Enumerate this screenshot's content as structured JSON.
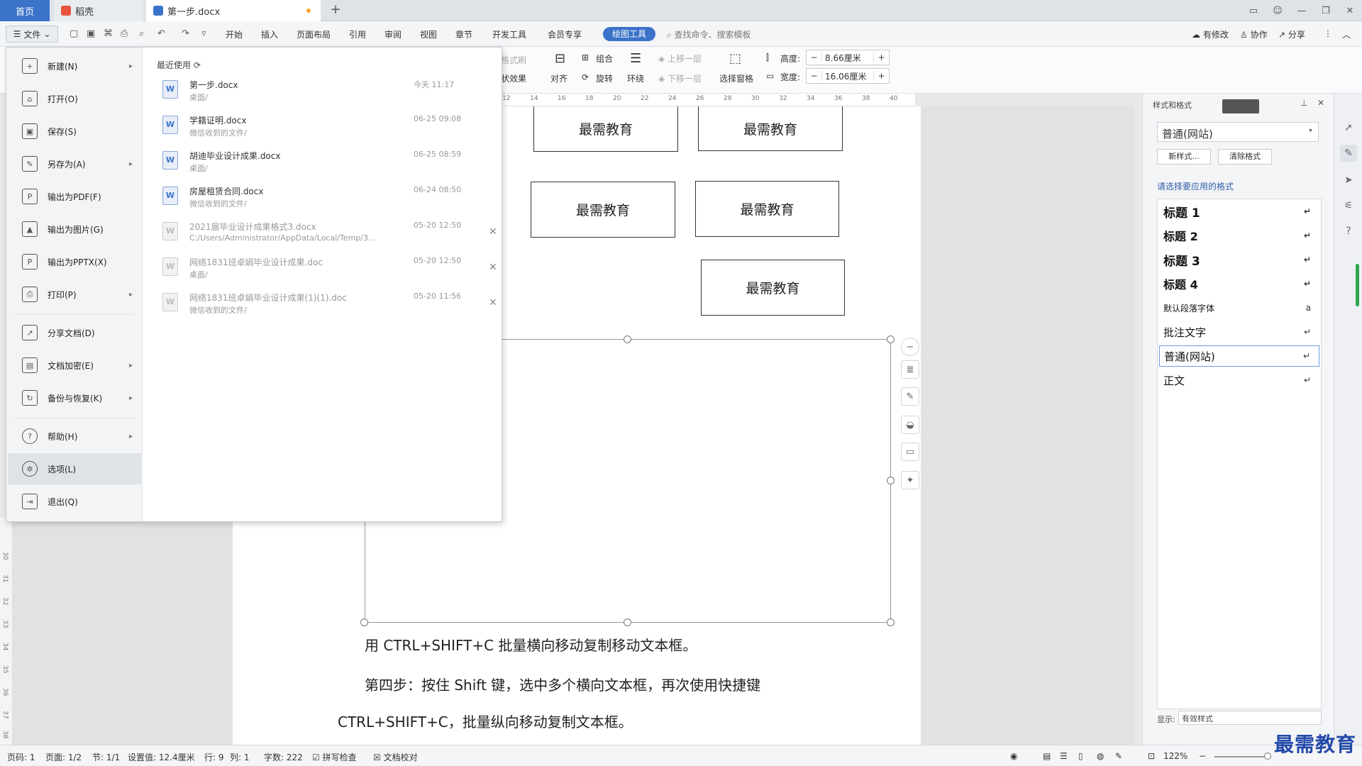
{
  "titlebar": {
    "tab_home": "首页",
    "tab_daoke": "稻壳",
    "tab_doc": "第一步.docx",
    "new_tab": "+"
  },
  "menubar": {
    "file": "文件",
    "items": [
      "开始",
      "插入",
      "页面布局",
      "引用",
      "审阅",
      "视图",
      "章节",
      "开发工具",
      "会员专享"
    ],
    "active_tab": "绘图工具",
    "search": "查找命令、搜索模板",
    "modified": "有修改",
    "collaborate": "协作",
    "share": "分享"
  },
  "ribbon": {
    "format_painter": "格式刷",
    "shape_effect": "状效果",
    "align": "对齐",
    "group": "组合",
    "rotate": "旋转",
    "wrap": "环绕",
    "bring_forward": "上移一层",
    "send_backward": "下移一层",
    "select_pane": "选择窗格",
    "height_label": "高度:",
    "height_value": "8.66厘米",
    "width_label": "宽度:",
    "width_value": "16.06厘米"
  },
  "ruler": {
    "ticks": [
      "12",
      "14",
      "16",
      "18",
      "20",
      "22",
      "24",
      "26",
      "28",
      "30",
      "32",
      "34",
      "36",
      "38",
      "40"
    ]
  },
  "vruler": {
    "ticks": [
      "30",
      "31",
      "32",
      "33",
      "34",
      "35",
      "36",
      "37",
      "38",
      "39"
    ]
  },
  "file_menu": {
    "items": [
      {
        "label": "新建(N)",
        "arrow": true
      },
      {
        "label": "打开(O)",
        "arrow": false
      },
      {
        "label": "保存(S)",
        "arrow": false
      },
      {
        "label": "另存为(A)",
        "arrow": true
      },
      {
        "label": "输出为PDF(F)",
        "arrow": false
      },
      {
        "label": "输出为图片(G)",
        "arrow": false
      },
      {
        "label": "输出为PPTX(X)",
        "arrow": false
      },
      {
        "label": "打印(P)",
        "arrow": true
      },
      {
        "label": "分享文档(D)",
        "arrow": false
      },
      {
        "label": "文档加密(E)",
        "arrow": true
      },
      {
        "label": "备份与恢复(K)",
        "arrow": true
      },
      {
        "label": "帮助(H)",
        "arrow": true
      },
      {
        "label": "选项(L)",
        "arrow": false
      },
      {
        "label": "退出(Q)",
        "arrow": false
      }
    ],
    "recent_title": "最近使用",
    "recent": [
      {
        "name": "第一步.docx",
        "path": "桌面/",
        "time": "今天 11:17",
        "gray": false
      },
      {
        "name": "学籍证明.docx",
        "path": "微信收到的文件/",
        "time": "06-25 09:08",
        "gray": false
      },
      {
        "name": "胡迪毕业设计成果.docx",
        "path": "桌面/",
        "time": "06-25 08:59",
        "gray": false
      },
      {
        "name": "房屋租赁合同.docx",
        "path": "微信收到的文件/",
        "time": "06-24 08:50",
        "gray": false
      },
      {
        "name": "2021届毕业设计成果格式3.docx",
        "path": "C:/Users/Administrator/AppData/Local/Temp/3...",
        "time": "05-20 12:50",
        "gray": true
      },
      {
        "name": "网络1831班卓娟毕业设计成果.doc",
        "path": "桌面/",
        "time": "05-20 12:50",
        "gray": true
      },
      {
        "name": "网络1831班卓娟毕业设计成果(1)(1).doc",
        "path": "微信收到的文件/",
        "time": "05-20 11:56",
        "gray": true
      }
    ]
  },
  "document": {
    "box_text": "最需教育",
    "para1": "用 CTRL+SHIFT+C 批量横向移动复制移动文本框。",
    "para2": "第四步：按住 Shift 键，选中多个横向文本框，再次使用快捷键",
    "para3": "CTRL+SHIFT+C，批量纵向移动复制文本框。"
  },
  "right_panel": {
    "title": "样式和格式",
    "current_style": "普通(网站)",
    "new_style": "新样式...",
    "clear_format": "清除格式",
    "hint": "请选择要应用的格式",
    "styles": [
      {
        "name": "标题  1",
        "mark": "↵"
      },
      {
        "name": "标题  2",
        "mark": "↵"
      },
      {
        "name": "标题  3",
        "mark": "↵"
      },
      {
        "name": "标题  4",
        "mark": "↵"
      },
      {
        "name": "默认段落字体",
        "mark": "a"
      },
      {
        "name": "批注文字",
        "mark": "↵"
      },
      {
        "name": "普通(网站)",
        "mark": "↵"
      },
      {
        "name": "正文",
        "mark": "↵"
      }
    ],
    "show_label": "显示:",
    "show_value": "有效样式"
  },
  "statusbar": {
    "page_num": "页码: 1",
    "page": "页面: 1/2",
    "section": "节: 1/1",
    "setting": "设置值: 12.4厘米",
    "row": "行: 9",
    "col": "列: 1",
    "words": "字数: 222",
    "spell": "拼写检查",
    "proof": "文档校对",
    "zoom": "122%"
  },
  "watermark": "最需教育",
  "colors": {
    "accent": "#3b73c9",
    "watermark": "#2248a8"
  }
}
